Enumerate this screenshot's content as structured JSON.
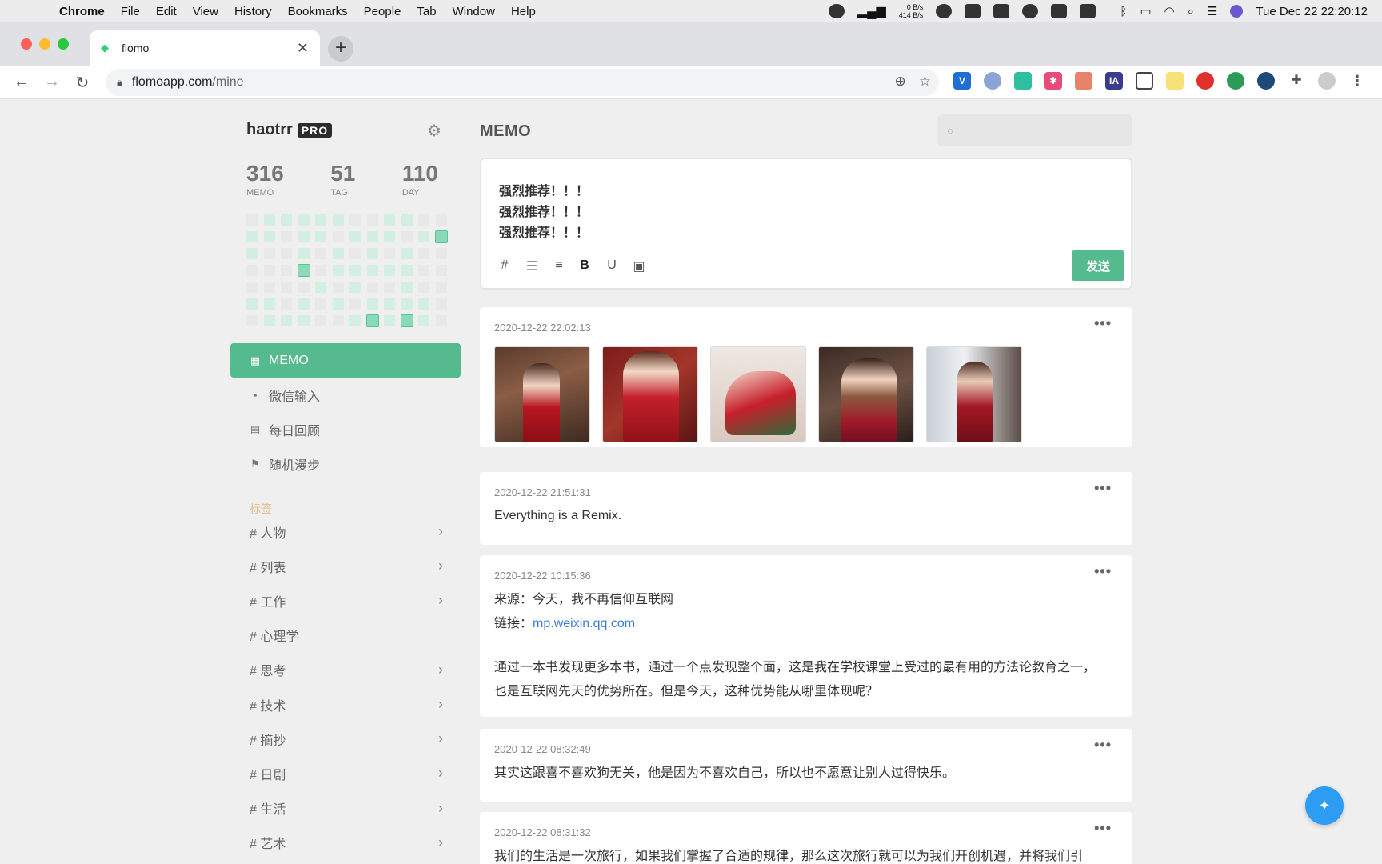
{
  "menubar": {
    "app": "Chrome",
    "items": [
      "File",
      "Edit",
      "View",
      "History",
      "Bookmarks",
      "People",
      "Tab",
      "Window",
      "Help"
    ],
    "net_up": "0 B/s",
    "net_down": "414 B/s",
    "clock": "Tue Dec 22  22:20:12"
  },
  "browser": {
    "tab_title": "flomo",
    "url_host": "flomoapp.com",
    "url_path": "/mine"
  },
  "sidebar": {
    "username": "haotrr",
    "badge": "PRO",
    "stats": [
      {
        "value": "316",
        "label": "MEMO"
      },
      {
        "value": "51",
        "label": "TAG"
      },
      {
        "value": "110",
        "label": "DAY"
      }
    ],
    "heatmap": [
      [
        0,
        1,
        1,
        1,
        1,
        1,
        0,
        0,
        1,
        1,
        0,
        0
      ],
      [
        1,
        1,
        0,
        1,
        1,
        0,
        1,
        1,
        1,
        0,
        1,
        3
      ],
      [
        1,
        0,
        0,
        1,
        0,
        1,
        0,
        1,
        0,
        1,
        0,
        0
      ],
      [
        0,
        0,
        0,
        3,
        0,
        1,
        1,
        1,
        1,
        1,
        0,
        0
      ],
      [
        0,
        0,
        0,
        0,
        1,
        0,
        1,
        0,
        0,
        1,
        0,
        0
      ],
      [
        1,
        1,
        0,
        1,
        0,
        1,
        0,
        1,
        1,
        1,
        1,
        0
      ],
      [
        0,
        1,
        1,
        1,
        0,
        0,
        1,
        3,
        1,
        3,
        1,
        0
      ]
    ],
    "nav": [
      {
        "label": "MEMO",
        "icon": "grid-icon",
        "active": true
      },
      {
        "label": "微信输入",
        "icon": "chat-icon",
        "active": false
      },
      {
        "label": "每日回顾",
        "icon": "calendar-icon",
        "active": false
      },
      {
        "label": "随机漫步",
        "icon": "signpost-icon",
        "active": false
      }
    ],
    "tags_heading": "标签",
    "tags": [
      {
        "label": "# 人物",
        "expandable": true
      },
      {
        "label": "# 列表",
        "expandable": true
      },
      {
        "label": "# 工作",
        "expandable": true
      },
      {
        "label": "# 心理学",
        "expandable": false
      },
      {
        "label": "# 思考",
        "expandable": true
      },
      {
        "label": "# 技术",
        "expandable": true
      },
      {
        "label": "# 摘抄",
        "expandable": true
      },
      {
        "label": "# 日剧",
        "expandable": true
      },
      {
        "label": "# 生活",
        "expandable": true
      },
      {
        "label": "# 艺术",
        "expandable": true
      }
    ]
  },
  "main": {
    "title": "MEMO",
    "search_placeholder": "",
    "editor": {
      "lines": [
        "强烈推荐！！！",
        "强烈推荐！！！",
        "强烈推荐！！！"
      ],
      "tools": [
        "#",
        "bullet-list-icon",
        "numbered-list-icon",
        "B",
        "U",
        "image-icon"
      ],
      "send_label": "发送"
    },
    "memos": [
      {
        "time": "2020-12-22 22:02:13",
        "images": 5
      },
      {
        "time": "2020-12-22 21:51:31",
        "text": "Everything is a Remix."
      },
      {
        "time": "2020-12-22 10:15:36",
        "source": "来源：今天，我不再信仰互联网",
        "link_prefix": "链接：",
        "link_text": "mp.weixin.qq.com",
        "paragraph": "通过一本书发现更多本书，通过一个点发现整个面，这是我在学校课堂上受过的最有用的方法论教育之一，也是互联网先天的优势所在。但是今天，这种优势能从哪里体现呢？"
      },
      {
        "time": "2020-12-22 08:32:49",
        "text": "其实这跟喜不喜欢狗无关，他是因为不喜欢自己，所以也不愿意让别人过得快乐。"
      },
      {
        "time": "2020-12-22 08:31:32",
        "text": "我们的生活是一次旅行，如果我们掌握了合适的规律，那么这次旅行就可以为我们开创机遇，并将我们引"
      }
    ]
  },
  "colors": {
    "accent": "#55bb8e",
    "fab": "#2d9cf3",
    "link": "#3a7bd5",
    "tags_heading": "#e7bd8f"
  }
}
